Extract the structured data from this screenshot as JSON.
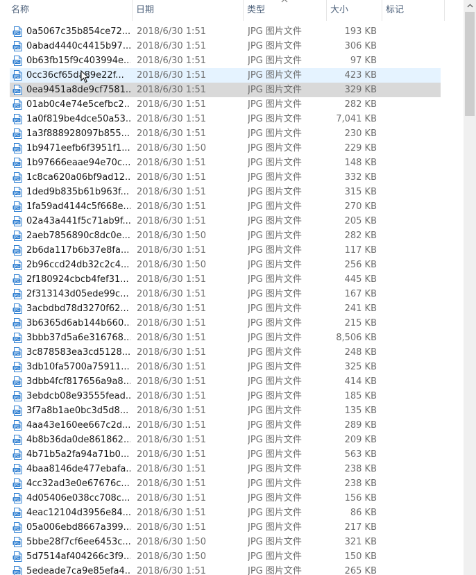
{
  "columns": {
    "name": "名称",
    "date": "日期",
    "type": "类型",
    "size": "大小",
    "tag": "标记"
  },
  "sort_indicator": "^",
  "files": [
    {
      "name": "0a5067c35b854ce72...",
      "date": "2018/6/30 1:51",
      "type": "JPG 图片文件",
      "size": "193 KB",
      "state": ""
    },
    {
      "name": "0abad4440c4415b97...",
      "date": "2018/6/30 1:51",
      "type": "JPG 图片文件",
      "size": "306 KB",
      "state": ""
    },
    {
      "name": "0b63fb15f9c403994e...",
      "date": "2018/6/30 1:51",
      "type": "JPG 图片文件",
      "size": "97 KB",
      "state": ""
    },
    {
      "name": "0cc36cf65da89e22f...",
      "date": "2018/6/30 1:51",
      "type": "JPG 图片文件",
      "size": "423 KB",
      "state": "hover"
    },
    {
      "name": "0ea9451a8de9cf7581...",
      "date": "2018/6/30 1:51",
      "type": "JPG 图片文件",
      "size": "329 KB",
      "state": "selected"
    },
    {
      "name": "01ab0c4e74e5cefbc2...",
      "date": "2018/6/30 1:51",
      "type": "JPG 图片文件",
      "size": "282 KB",
      "state": ""
    },
    {
      "name": "1a0f819be4dce50a53...",
      "date": "2018/6/30 1:51",
      "type": "JPG 图片文件",
      "size": "7,041 KB",
      "state": ""
    },
    {
      "name": "1a3f888928097b855...",
      "date": "2018/6/30 1:51",
      "type": "JPG 图片文件",
      "size": "230 KB",
      "state": ""
    },
    {
      "name": "1b9471eefb6f3951f1...",
      "date": "2018/6/30 1:50",
      "type": "JPG 图片文件",
      "size": "229 KB",
      "state": ""
    },
    {
      "name": "1b97666eaae94e70c...",
      "date": "2018/6/30 1:51",
      "type": "JPG 图片文件",
      "size": "148 KB",
      "state": ""
    },
    {
      "name": "1c8ca620a06bf9ad12...",
      "date": "2018/6/30 1:51",
      "type": "JPG 图片文件",
      "size": "332 KB",
      "state": ""
    },
    {
      "name": "1ded9b835b61b963f...",
      "date": "2018/6/30 1:51",
      "type": "JPG 图片文件",
      "size": "315 KB",
      "state": ""
    },
    {
      "name": "1fa59ad4144c5f668e...",
      "date": "2018/6/30 1:51",
      "type": "JPG 图片文件",
      "size": "270 KB",
      "state": ""
    },
    {
      "name": "02a43a441f5c71ab9f...",
      "date": "2018/6/30 1:51",
      "type": "JPG 图片文件",
      "size": "205 KB",
      "state": ""
    },
    {
      "name": "2aeb7856890c8dc0e...",
      "date": "2018/6/30 1:50",
      "type": "JPG 图片文件",
      "size": "282 KB",
      "state": ""
    },
    {
      "name": "2b6da117b6b37e8fa...",
      "date": "2018/6/30 1:51",
      "type": "JPG 图片文件",
      "size": "117 KB",
      "state": ""
    },
    {
      "name": "2b96ccd24db32c2c4...",
      "date": "2018/6/30 1:50",
      "type": "JPG 图片文件",
      "size": "256 KB",
      "state": ""
    },
    {
      "name": "2f180924cbcb4fef31...",
      "date": "2018/6/30 1:51",
      "type": "JPG 图片文件",
      "size": "445 KB",
      "state": ""
    },
    {
      "name": "2f313143d05ede99c...",
      "date": "2018/6/30 1:51",
      "type": "JPG 图片文件",
      "size": "167 KB",
      "state": ""
    },
    {
      "name": "3acbdbd78d3270f62...",
      "date": "2018/6/30 1:51",
      "type": "JPG 图片文件",
      "size": "241 KB",
      "state": ""
    },
    {
      "name": "3b6365d6ab144b660...",
      "date": "2018/6/30 1:51",
      "type": "JPG 图片文件",
      "size": "215 KB",
      "state": ""
    },
    {
      "name": "3bbb37d5a6e316768...",
      "date": "2018/6/30 1:51",
      "type": "JPG 图片文件",
      "size": "8,506 KB",
      "state": ""
    },
    {
      "name": "3c878583ea3cd5128...",
      "date": "2018/6/30 1:51",
      "type": "JPG 图片文件",
      "size": "248 KB",
      "state": ""
    },
    {
      "name": "3db10fa5700a75911...",
      "date": "2018/6/30 1:51",
      "type": "JPG 图片文件",
      "size": "325 KB",
      "state": ""
    },
    {
      "name": "3dbb4fcf817656a9a8...",
      "date": "2018/6/30 1:51",
      "type": "JPG 图片文件",
      "size": "414 KB",
      "state": ""
    },
    {
      "name": "3ebdcb08e93555fead...",
      "date": "2018/6/30 1:51",
      "type": "JPG 图片文件",
      "size": "185 KB",
      "state": ""
    },
    {
      "name": "3f7a8b1ae0bc3d5d8...",
      "date": "2018/6/30 1:51",
      "type": "JPG 图片文件",
      "size": "135 KB",
      "state": ""
    },
    {
      "name": "4aa43e160ee667c2d...",
      "date": "2018/6/30 1:51",
      "type": "JPG 图片文件",
      "size": "289 KB",
      "state": ""
    },
    {
      "name": "4b8b36da0de861862...",
      "date": "2018/6/30 1:51",
      "type": "JPG 图片文件",
      "size": "209 KB",
      "state": ""
    },
    {
      "name": "4b71b5a2fa94a71b0...",
      "date": "2018/6/30 1:51",
      "type": "JPG 图片文件",
      "size": "563 KB",
      "state": ""
    },
    {
      "name": "4baa8146de477ebafa...",
      "date": "2018/6/30 1:51",
      "type": "JPG 图片文件",
      "size": "238 KB",
      "state": ""
    },
    {
      "name": "4cc32ad3e0e67676c...",
      "date": "2018/6/30 1:51",
      "type": "JPG 图片文件",
      "size": "238 KB",
      "state": ""
    },
    {
      "name": "4d05406e038cc708c...",
      "date": "2018/6/30 1:51",
      "type": "JPG 图片文件",
      "size": "156 KB",
      "state": ""
    },
    {
      "name": "4eac12104d3956e84...",
      "date": "2018/6/30 1:51",
      "type": "JPG 图片文件",
      "size": "86 KB",
      "state": ""
    },
    {
      "name": "05a006ebd8667a399...",
      "date": "2018/6/30 1:51",
      "type": "JPG 图片文件",
      "size": "217 KB",
      "state": ""
    },
    {
      "name": "5bbe28f7cf6ee6453c...",
      "date": "2018/6/30 1:50",
      "type": "JPG 图片文件",
      "size": "321 KB",
      "state": ""
    },
    {
      "name": "5d7514af404266c3f9...",
      "date": "2018/6/30 1:50",
      "type": "JPG 图片文件",
      "size": "150 KB",
      "state": ""
    },
    {
      "name": "5edeade7ca9e85efa4...",
      "date": "2018/6/30 1:51",
      "type": "JPG 图片文件",
      "size": "265 KB",
      "state": ""
    }
  ],
  "icons": {
    "file": "jpg-file-icon",
    "cursor": "mouse-cursor-icon"
  },
  "colors": {
    "hover": "#e5f3ff",
    "selected": "#d9d9d9",
    "header_text": "#4c607a",
    "icon_blue": "#2f7fd1"
  }
}
